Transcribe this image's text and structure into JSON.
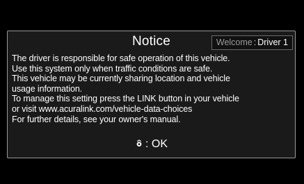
{
  "dialog": {
    "title": "Notice",
    "welcome": {
      "label": "Welcome",
      "separator": ":",
      "driver": "Driver 1"
    },
    "message_lines": [
      "The driver is responsible for safe operation of this vehicle.",
      "Use this system only when traffic conditions are safe.",
      "This vehicle may be currently sharing location and vehicle",
      "usage information.",
      "To manage this setting press the LINK button in your vehicle",
      "or visit www.acuralink.com/vehicle-data-choices",
      "For further details, see your owner's manual."
    ],
    "ok": {
      "icon": "interface-dial-icon",
      "label": ": OK"
    }
  },
  "colors": {
    "background": "#000000",
    "dialog_background": "#1a1a1a",
    "dialog_border": "#9a9a9a",
    "text": "#ffffff",
    "muted_text": "#9a9a9a"
  }
}
